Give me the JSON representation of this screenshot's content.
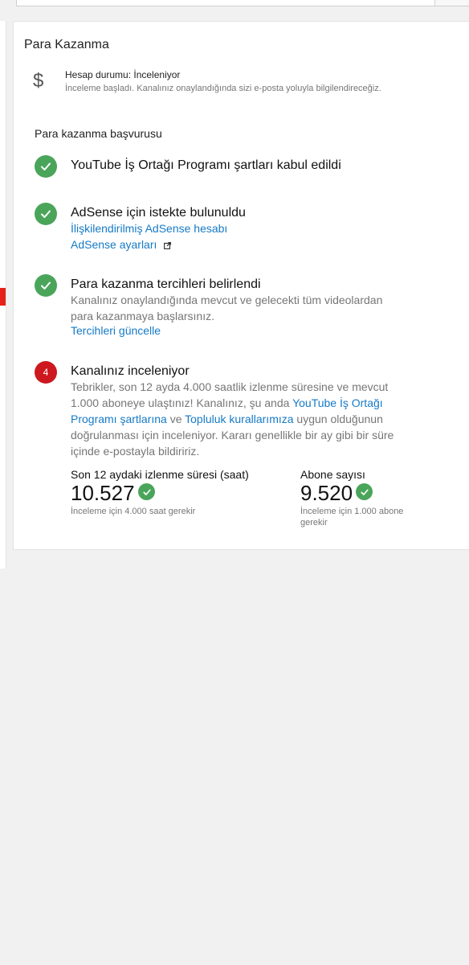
{
  "card": {
    "title": "Para Kazanma",
    "status_line": "Hesap durumu: İnceleniyor",
    "status_sub": "İnceleme başladı. Kanalınız onaylandığında sizi e-posta yoluyla bilgilendireceğiz.",
    "dollar_symbol": "$",
    "section_title": "Para kazanma başvurusu"
  },
  "steps": {
    "s1_title": "YouTube İş Ortağı Programı şartları kabul edildi",
    "s2_title": "AdSense için istekte bulunuldu",
    "s2_link1": "İlişkilendirilmiş AdSense hesabı",
    "s2_link2": "AdSense ayarları",
    "s3_title": "Para kazanma tercihleri belirlendi",
    "s3_text": "Kanalınız onaylandığında mevcut ve gelecekti tüm videolardan para kazanmaya başlarsınız.",
    "s3_link": "Tercihleri güncelle",
    "s4_number": "4",
    "s4_title": "Kanalınız inceleniyor",
    "s4_text_a": "Tebrikler, son 12 ayda 4.000 saatlik izlenme süresine ve mevcut 1.000 aboneye ulaştınız! Kanalınız, şu anda ",
    "s4_link_a": "YouTube İş Ortağı Programı şartlarına",
    "s4_text_b": " ve ",
    "s4_link_b": "Topluluk kurallarımıza",
    "s4_text_c": " uygun olduğunun doğrulanması için inceleniyor. Kararı genellikle bir ay gibi bir süre içinde e-postayla bildiririz."
  },
  "metrics": {
    "watch_label": "Son 12 aydaki izlenme süresi (saat)",
    "watch_value": "10.527",
    "watch_note": "İnceleme için 4.000 saat gerekir",
    "subs_label": "Abone sayısı",
    "subs_value": "9.520",
    "subs_note": "İnceleme için 1.000 abone gerekir"
  },
  "colors": {
    "check_green": "#4aa55a",
    "step_red": "#cc181e",
    "link_blue": "#167ac6",
    "sidebar_red": "#e62117"
  }
}
